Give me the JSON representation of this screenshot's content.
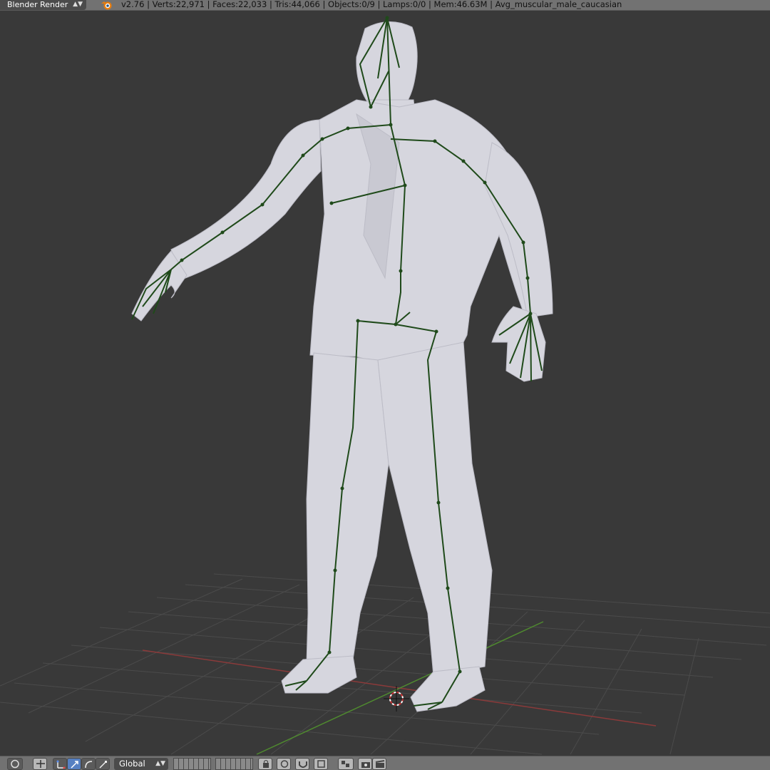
{
  "header": {
    "render_engine": "Blender Render",
    "stats": "v2.76 | Verts:22,971 | Faces:22,033 | Tris:44,066 | Objects:0/9 | Lamps:0/0 | Mem:46.63M | Avg_muscular_male_caucasian"
  },
  "viewport": {
    "background": "#393939",
    "grid_color": "#4a4a4a",
    "x_axis_color": "#8b3a3a",
    "y_axis_color": "#4f8a2f",
    "mesh_color": "#d4d4dc",
    "bone_color": "#1f4a1a"
  },
  "toolbar": {
    "transform_orientation": "Global"
  }
}
